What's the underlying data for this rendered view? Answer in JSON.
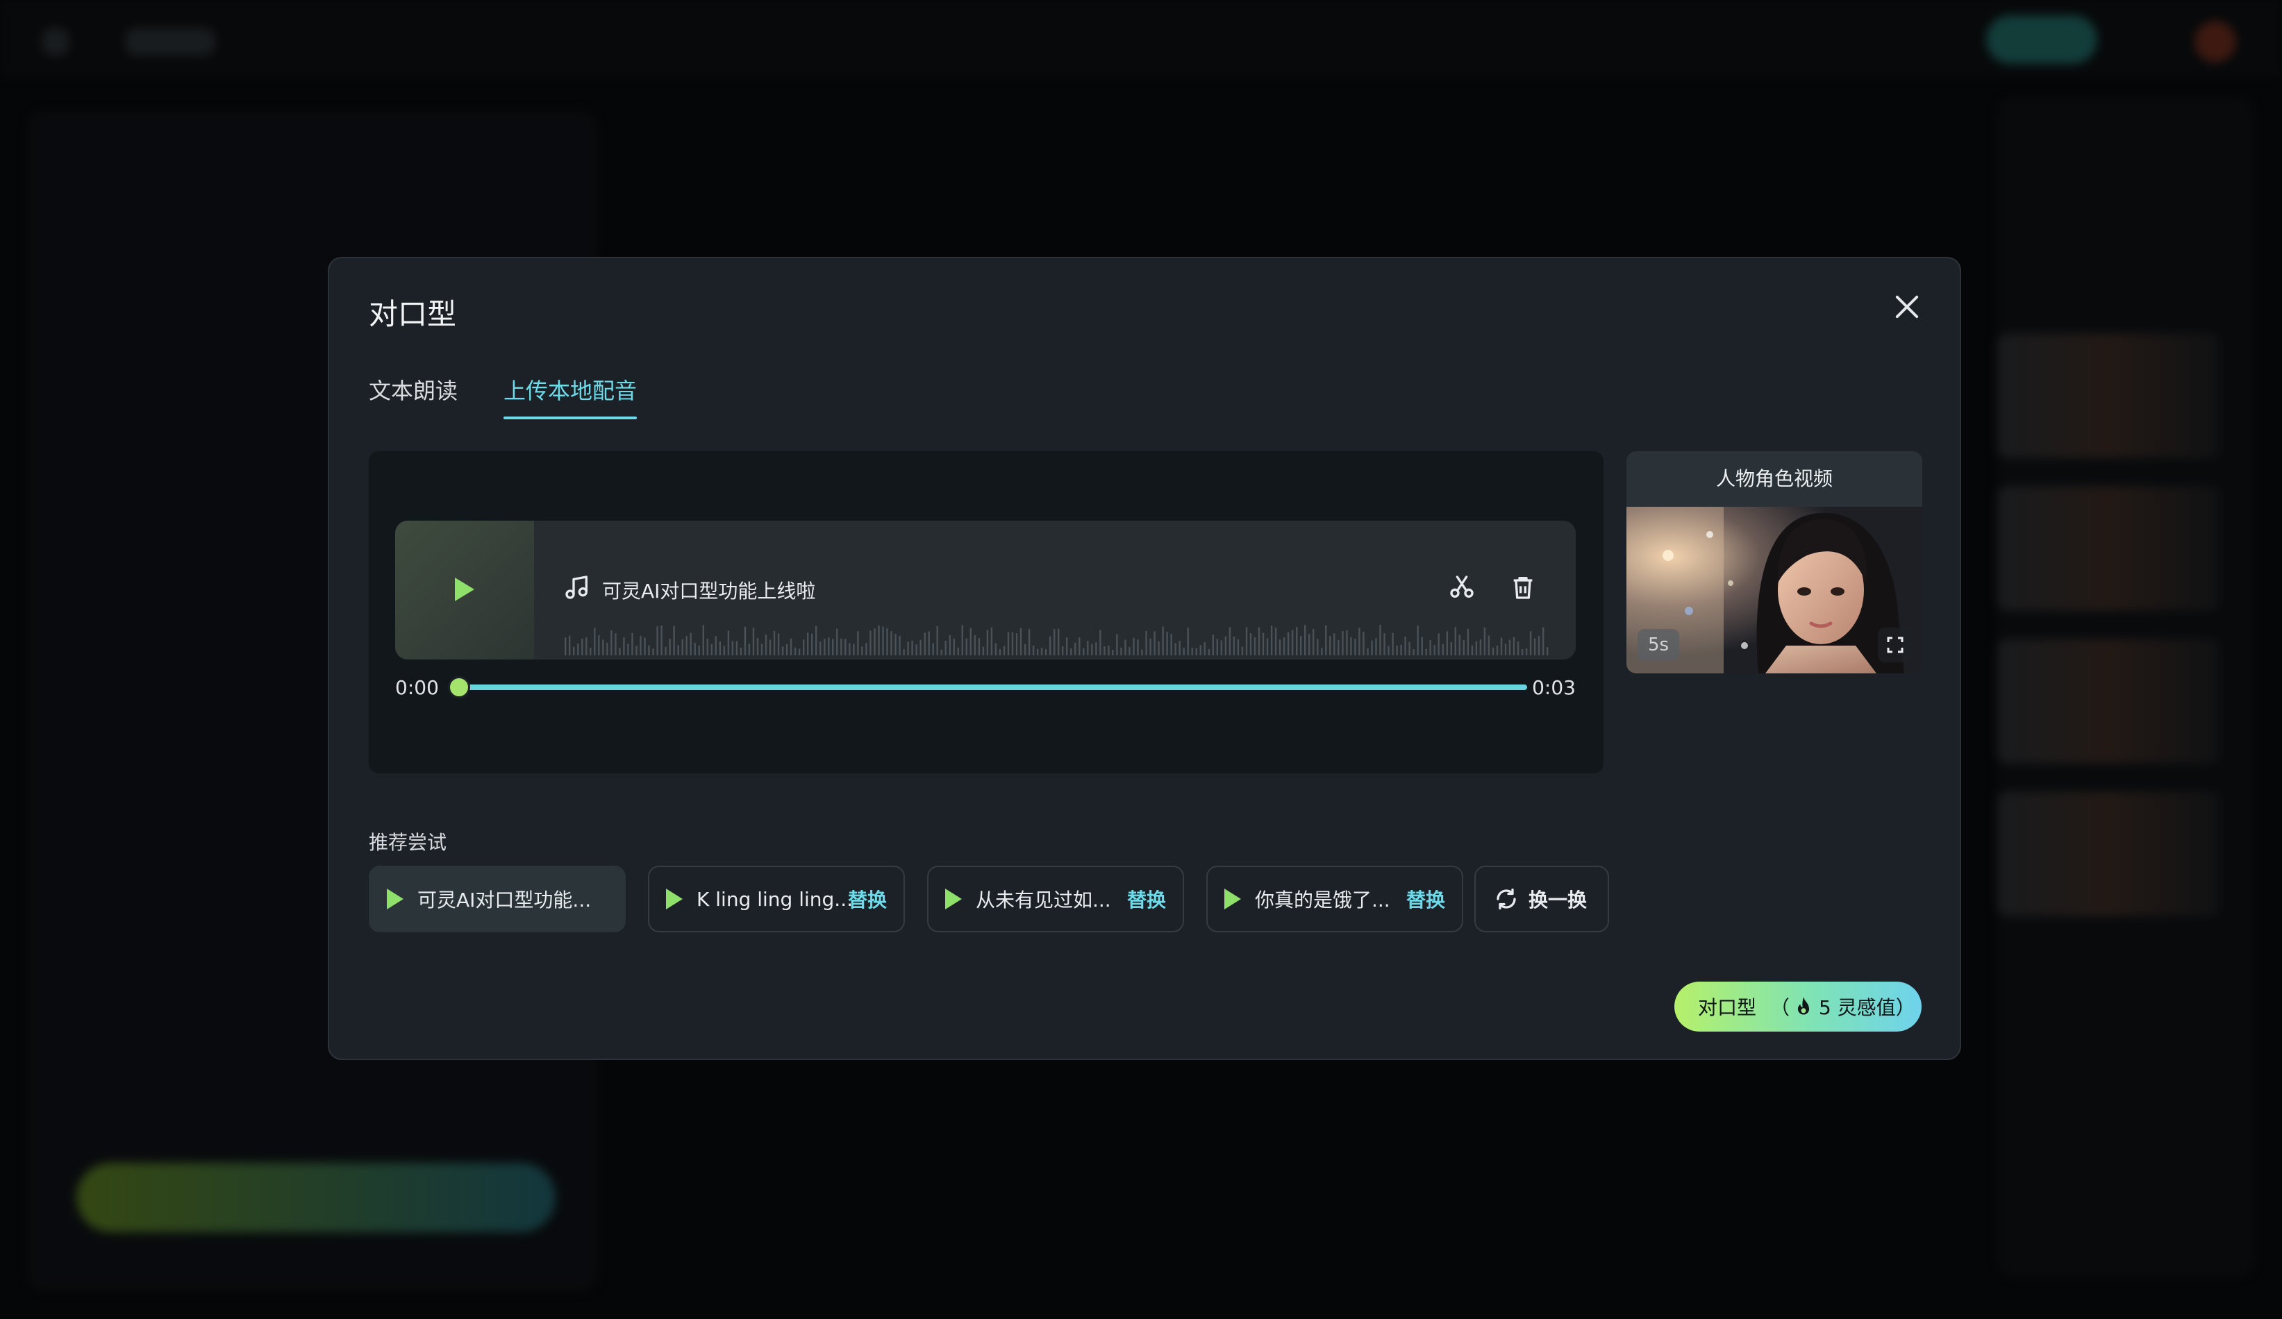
{
  "modal": {
    "title": "对口型",
    "tabs": [
      {
        "label": "文本朗读",
        "active": false
      },
      {
        "label": "上传本地配音",
        "active": true
      }
    ]
  },
  "audio": {
    "file_name": "可灵AI对口型功能上线啦",
    "time_start": "0:00",
    "time_end": "0:03",
    "progress": 0
  },
  "character_video": {
    "label": "人物角色视频",
    "duration": "5s"
  },
  "recommend": {
    "label": "推荐尝试",
    "items": [
      {
        "text": "可灵AI对口型功能...",
        "action": ""
      },
      {
        "text": "K ling ling ling...",
        "action": "替换"
      },
      {
        "text": "从未有见过如...",
        "action": "替换"
      },
      {
        "text": "你真的是饿了...",
        "action": "替换"
      }
    ],
    "refresh_label": "换一换"
  },
  "submit": {
    "label": "对口型",
    "cost_open": "（",
    "cost_value": "5 灵感值",
    "cost_close": "）"
  },
  "colors": {
    "accent": "#6fdbea",
    "play": "#8fe06b",
    "modal_bg": "#1b2126"
  }
}
